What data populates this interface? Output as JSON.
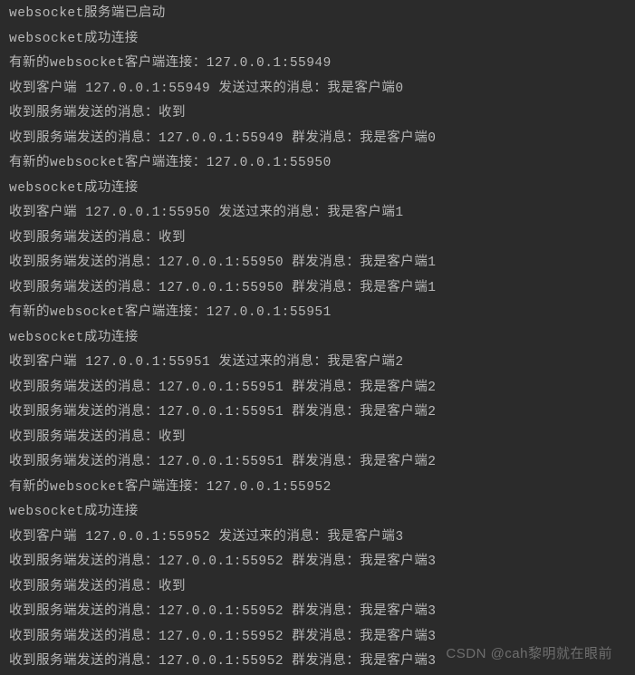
{
  "console": {
    "lines": [
      "websocket服务端已启动",
      "websocket成功连接",
      "有新的websocket客户端连接：127.0.0.1:55949",
      "收到客户端 127.0.0.1:55949 发送过来的消息：我是客户端0",
      "收到服务端发送的消息：收到",
      "收到服务端发送的消息：127.0.0.1:55949 群发消息：我是客户端0",
      "有新的websocket客户端连接：127.0.0.1:55950",
      "websocket成功连接",
      "收到客户端 127.0.0.1:55950 发送过来的消息：我是客户端1",
      "收到服务端发送的消息：收到",
      "收到服务端发送的消息：127.0.0.1:55950 群发消息：我是客户端1",
      "收到服务端发送的消息：127.0.0.1:55950 群发消息：我是客户端1",
      "有新的websocket客户端连接：127.0.0.1:55951",
      "websocket成功连接",
      "收到客户端 127.0.0.1:55951 发送过来的消息：我是客户端2",
      "收到服务端发送的消息：127.0.0.1:55951 群发消息：我是客户端2",
      "收到服务端发送的消息：127.0.0.1:55951 群发消息：我是客户端2",
      "收到服务端发送的消息：收到",
      "收到服务端发送的消息：127.0.0.1:55951 群发消息：我是客户端2",
      "有新的websocket客户端连接：127.0.0.1:55952",
      "websocket成功连接",
      "收到客户端 127.0.0.1:55952 发送过来的消息：我是客户端3",
      "收到服务端发送的消息：127.0.0.1:55952 群发消息：我是客户端3",
      "收到服务端发送的消息：收到",
      "收到服务端发送的消息：127.0.0.1:55952 群发消息：我是客户端3",
      "收到服务端发送的消息：127.0.0.1:55952 群发消息：我是客户端3",
      "收到服务端发送的消息：127.0.0.1:55952 群发消息：我是客户端3"
    ]
  },
  "watermark": "CSDN @cah黎明就在眼前"
}
